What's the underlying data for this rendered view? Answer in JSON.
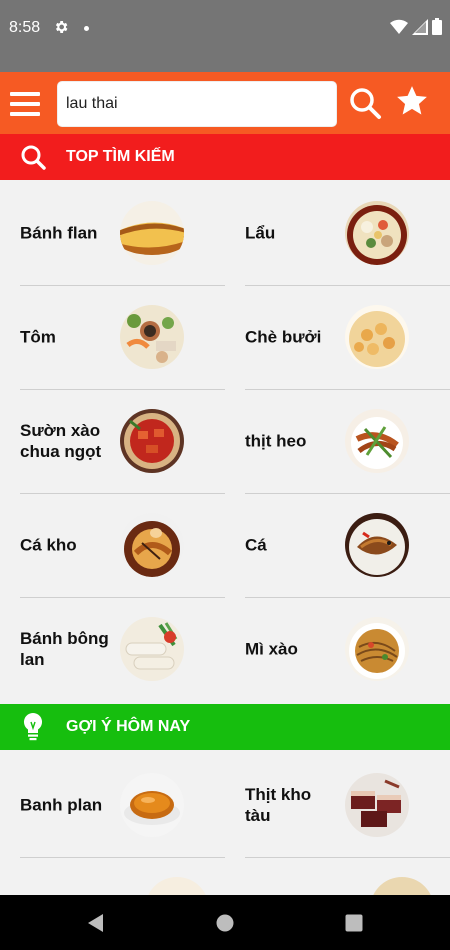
{
  "status_bar": {
    "time": "8:58"
  },
  "search": {
    "value": "lau thai"
  },
  "sections": {
    "top": {
      "title": "TOP TÌM KIẾM",
      "color": "#f21d1d"
    },
    "suggest": {
      "title": "GỢI Ý HÔM NAY",
      "color": "#16be0e"
    }
  },
  "top_items": [
    {
      "name": "Bánh flan",
      "icon": "flan-photo"
    },
    {
      "name": "Lẩu",
      "icon": "hotpot-photo"
    },
    {
      "name": "Tôm",
      "icon": "shrimp-platter-photo"
    },
    {
      "name": "Chè bưởi",
      "icon": "sweet-soup-photo"
    },
    {
      "name": "Sườn xào chua ngọt",
      "icon": "sweet-sour-ribs-photo"
    },
    {
      "name": "thịt heo",
      "icon": "pork-stirfry-photo"
    },
    {
      "name": "Cá kho",
      "icon": "braised-fish-photo"
    },
    {
      "name": "Cá",
      "icon": "fried-fish-photo"
    },
    {
      "name": "Bánh bông lan",
      "icon": "spring-rolls-photo"
    },
    {
      "name": "Mì xào",
      "icon": "fried-noodles-photo"
    }
  ],
  "suggest_items": [
    {
      "name": "Banh plan",
      "icon": "caramel-flan-photo"
    },
    {
      "name": "Thịt kho tàu",
      "icon": "braised-pork-photo"
    }
  ],
  "colors": {
    "app_bar": "#f65a23",
    "status_bar": "#757575",
    "background": "#f2f2f2"
  }
}
